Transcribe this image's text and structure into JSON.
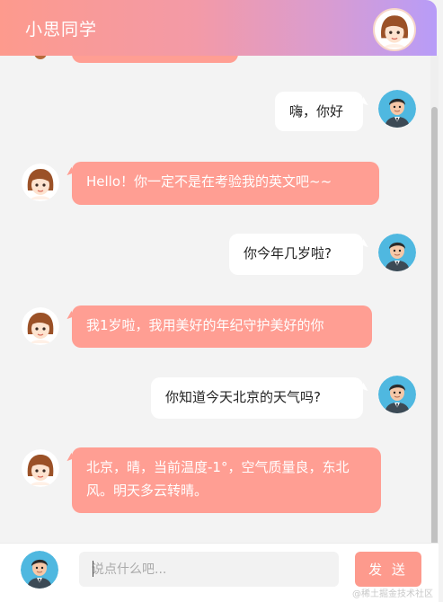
{
  "header": {
    "title": "小思同学"
  },
  "messages": [
    {
      "role": "user",
      "text": "嗨，你好"
    },
    {
      "role": "bot",
      "text": "Hello！你一定不是在考验我的英文吧~~"
    },
    {
      "role": "user",
      "text": "你今年几岁啦?"
    },
    {
      "role": "bot",
      "text": "我1岁啦，我用美好的年纪守护美好的你"
    },
    {
      "role": "user",
      "text": "你知道今天北京的天气吗?"
    },
    {
      "role": "bot",
      "text": "北京，晴，当前温度-1°，空气质量良，东北风。明天多云转晴。"
    }
  ],
  "composer": {
    "placeholder": "说点什么吧...",
    "send_label": "发 送"
  },
  "watermark": "@稀土掘金技术社区",
  "colors": {
    "accent": "#fd9a8d",
    "bot_bubble": "#ff9e93",
    "user_bubble": "#ffffff",
    "header_end": "#b79cf8"
  }
}
